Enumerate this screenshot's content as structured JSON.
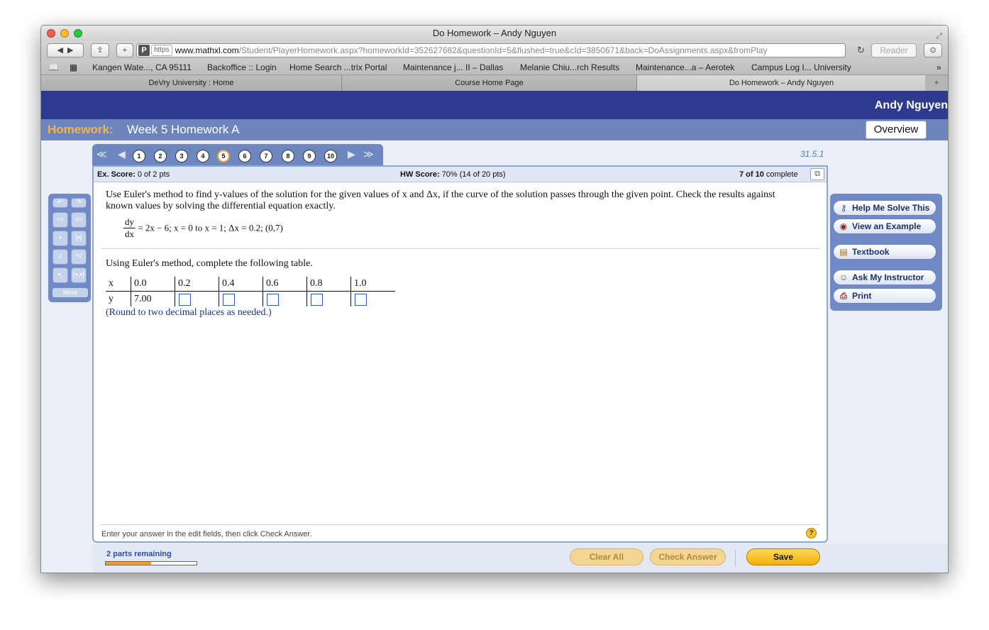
{
  "window": {
    "title": "Do Homework – Andy Nguyen"
  },
  "browser": {
    "url_https": "https",
    "url_domain": "www.mathxl.com",
    "url_path": "/Student/PlayerHomework.aspx?homeworkId=352627682&questionId=5&flushed=true&cId=3850671&back=DoAssignments.aspx&fromPlay",
    "reader_label": "Reader",
    "bookmarks": [
      "Kangen Wate..., CA 95111",
      "Backoffice :: Login",
      "Home Search ...trix Portal",
      "Maintenance j... II – Dallas",
      "Melanie Chiu...rch Results",
      "Maintenance...a – Aerotek",
      "Campus Log I... University"
    ],
    "tabs": [
      "DeVry University : Home",
      "Course Home Page",
      "Do Homework – Andy Nguyen"
    ]
  },
  "header": {
    "user_name": "Andy Nguyen",
    "homework_label": "Homework:",
    "homework_title": "Week 5 Homework A",
    "overview_label": "Overview"
  },
  "question_nav": {
    "numbers": [
      "1",
      "2",
      "3",
      "4",
      "5",
      "6",
      "7",
      "8",
      "9",
      "10"
    ],
    "checkmark": "✓",
    "version": "31.5.1"
  },
  "score": {
    "ex_label": "Ex. Score:",
    "ex_value": "0 of 2 pts",
    "hw_label": "HW Score:",
    "hw_value": "70% (14 of 20 pts)",
    "progress_bold": "7 of 10",
    "progress_text": "complete"
  },
  "question": {
    "text": "Use Euler's method to find y-values of the solution for the given values of x and Δx, if the curve of the solution passes through the given point. Check the results against known values by solving the differential equation exactly.",
    "eq_num": "dy",
    "eq_den": "dx",
    "eq_rest": "= 2x − 6; x = 0 to x = 1; Δx = 0.2; (0,7)",
    "instruction": "Using Euler's method, complete the following table.",
    "table_x_label": "x",
    "table_y_label": "y",
    "x_values": [
      "0.0",
      "0.2",
      "0.4",
      "0.6",
      "0.8",
      "1.0"
    ],
    "y_first": "7.00",
    "round_note": "(Round to two decimal places as needed.)"
  },
  "footer": {
    "note": "Enter your answer in the edit fields, then click Check Answer.",
    "help_icon": "?"
  },
  "right_tools": [
    {
      "label": "Help Me Solve This",
      "icon": "key-icon"
    },
    {
      "label": "View an Example",
      "icon": "binoculars-icon"
    },
    {
      "label": "Textbook",
      "icon": "book-icon"
    },
    {
      "label": "Ask My Instructor",
      "icon": "person-icon"
    },
    {
      "label": "Print",
      "icon": "printer-icon"
    }
  ],
  "left_tools": {
    "more_label": "More"
  },
  "bottom": {
    "parts_remaining": "2 parts remaining",
    "progress_fraction": 0.5,
    "clear_all": "Clear All",
    "check_answer": "Check Answer",
    "save": "Save"
  },
  "colors": {
    "header_blue": "#2e3a8e",
    "bar_blue": "#6d84bd",
    "homework_orange": "#f5b342",
    "save_yellow": "#f2b10a",
    "link_blue": "#1a2f9a"
  }
}
